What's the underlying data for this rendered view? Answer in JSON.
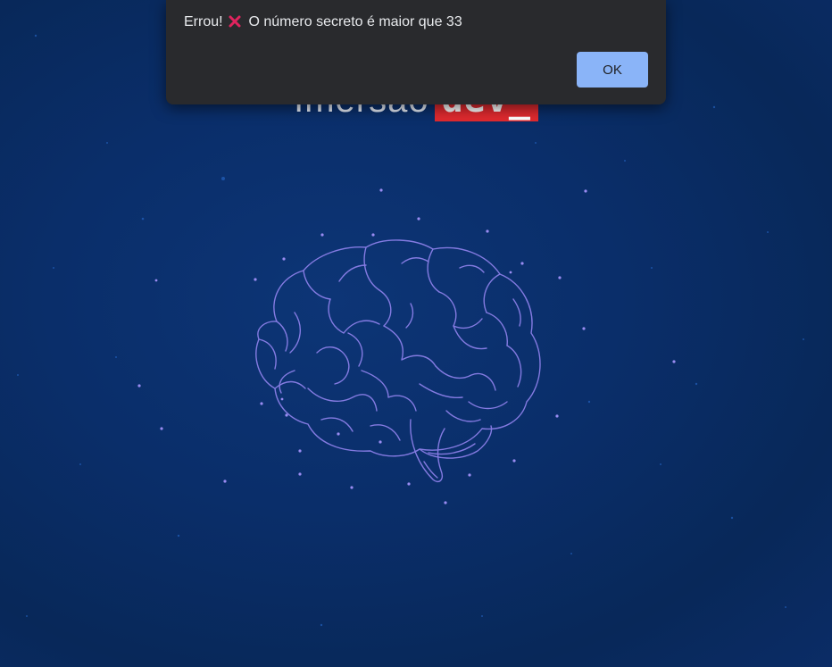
{
  "page": {
    "title_prefix": "Imersão",
    "title_badge": "dev_"
  },
  "dialog": {
    "message_prefix": "Errou!",
    "message_icon": "cross-mark-icon",
    "message_text": "O número secreto é maior que 33",
    "ok_label": "OK"
  },
  "colors": {
    "background": "#0a2e6a",
    "badge_red": "#e02a2f",
    "dialog_bg": "#292a2d",
    "button_blue": "#8ab4f8",
    "brain_line": "#8b7fe8",
    "cross_red": "#e0245e"
  }
}
